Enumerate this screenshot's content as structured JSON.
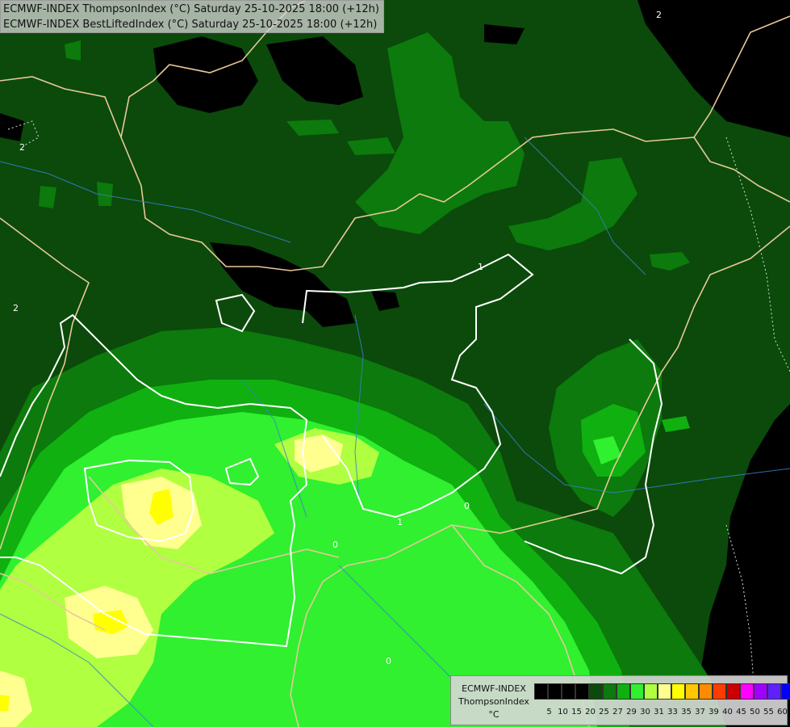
{
  "title": {
    "line1": "ECMWF-INDEX ThompsonIndex (°C) Saturday 25-10-2025 18:00 (+12h)",
    "line2": "ECMWF-INDEX BestLiftedIndex (°C) Saturday 25-10-2025 18:00 (+12h)"
  },
  "contour_labels": [
    "2",
    "2",
    "2",
    "1",
    "1",
    "0",
    "0",
    "0"
  ],
  "legend": {
    "model": "ECMWF-INDEX",
    "parameter": "ThompsonIndex",
    "unit": "°C",
    "ticks": [
      "5",
      "10",
      "15",
      "20",
      "25",
      "27",
      "29",
      "30",
      "31",
      "33",
      "35",
      "37",
      "39",
      "40",
      "45",
      "50",
      "55",
      "60"
    ],
    "colors": [
      "#000000",
      "#000000",
      "#000000",
      "#000000",
      "#0b4a0b",
      "#0c7a0c",
      "#10b010",
      "#30f030",
      "#b0ff40",
      "#ffff90",
      "#ffff00",
      "#ffc800",
      "#ff8c00",
      "#ff3c00",
      "#cc0000",
      "#ff00ff",
      "#a000ff",
      "#6020ff",
      "#0000ff"
    ]
  },
  "field_colors": {
    "black": "#000000",
    "dark_green": "#0b4a0b",
    "mid_green": "#0c7a0c",
    "green": "#10b010",
    "bright_green": "#30f030",
    "lime": "#b0ff40",
    "pale_yellow": "#ffff90",
    "yellow": "#ffff00",
    "border": "#e8c89a",
    "river": "#3a7fd0",
    "contour": "#ffffff"
  }
}
